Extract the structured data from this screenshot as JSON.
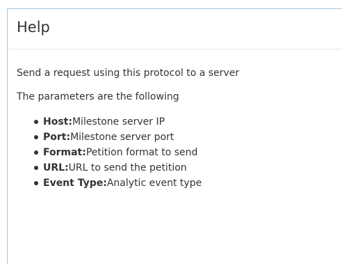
{
  "panel": {
    "title": "Help"
  },
  "body": {
    "description": "Send a request using this protocol to a server",
    "params_intro": "The parameters are the following",
    "params": [
      {
        "name": "Host:",
        "text": "Milestone server IP"
      },
      {
        "name": "Port:",
        "text": "Milestone server port"
      },
      {
        "name": "Format:",
        "text": "Petition format to send"
      },
      {
        "name": "URL:",
        "text": "URL to send the petition"
      },
      {
        "name": "Event Type:",
        "text": "Analytic event type"
      }
    ]
  }
}
